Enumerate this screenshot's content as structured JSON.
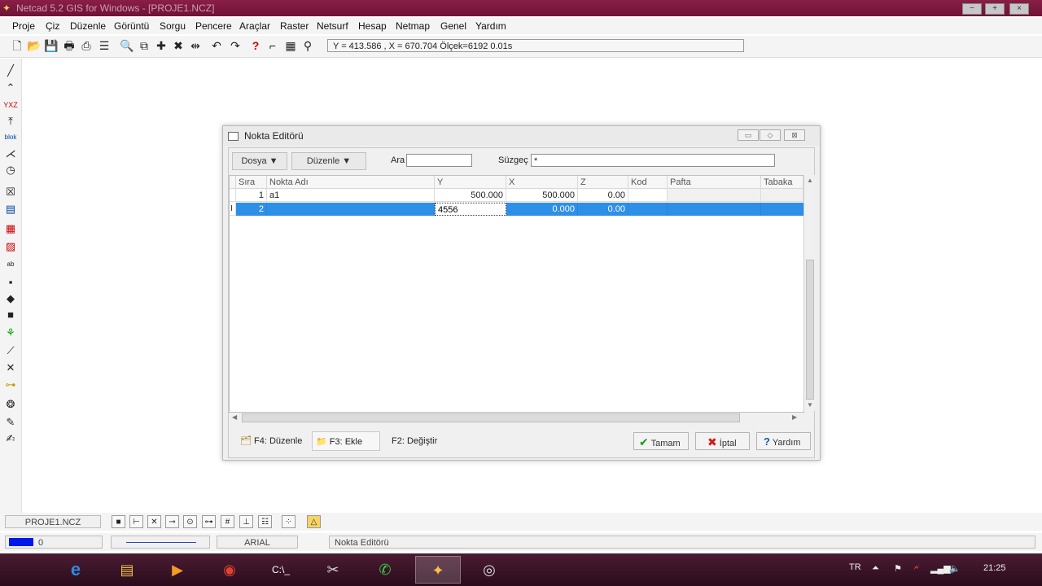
{
  "window": {
    "title": "Netcad 5.2 GIS for Windows - [PROJE1.NCZ]"
  },
  "menu": [
    "Proje",
    "Çiz",
    "Düzenle",
    "Görüntü",
    "Sorgu",
    "Pencere",
    "Araçlar",
    "Raster",
    "Netsurf",
    "Hesap",
    "Netmap",
    "Genel",
    "Yardım"
  ],
  "toolbar": {
    "coords": "Y = 413.586 , X = 670.704  Ölçek=6192   0.01s"
  },
  "dialog": {
    "title": "Nokta Editörü",
    "dosya": "Dosya ▼",
    "duzenle": "Düzenle ▼",
    "ara_label": "Ara",
    "ara_value": "",
    "suzgec_label": "Süzgeç",
    "suzgec_value": "*",
    "columns": [
      "Sıra",
      "Nokta Adı",
      "Y",
      "X",
      "Z",
      "Kod",
      "Pafta",
      "Tabaka"
    ],
    "rows": [
      {
        "sira": "1",
        "ad": "a1",
        "y": "500.000",
        "x": "500.000",
        "z": "0.00",
        "kod": "",
        "pafta": "",
        "tabaka": ""
      },
      {
        "sira": "2",
        "ad": "",
        "y": "4556",
        "x": "0.000",
        "z": "0.00",
        "kod": "",
        "pafta": "",
        "tabaka": ""
      }
    ],
    "f4": "F4: Düzenle",
    "f3": "F3: Ekle",
    "f2": "F2: Değiştir",
    "ok": "Tamam",
    "cancel": "İptal",
    "help": "Yardım"
  },
  "status": {
    "project": "PROJE1.NCZ",
    "layer": "0",
    "font": "ARIAL",
    "active_window": "Nokta Editörü",
    "lang": "TR",
    "clock": "21:25"
  }
}
